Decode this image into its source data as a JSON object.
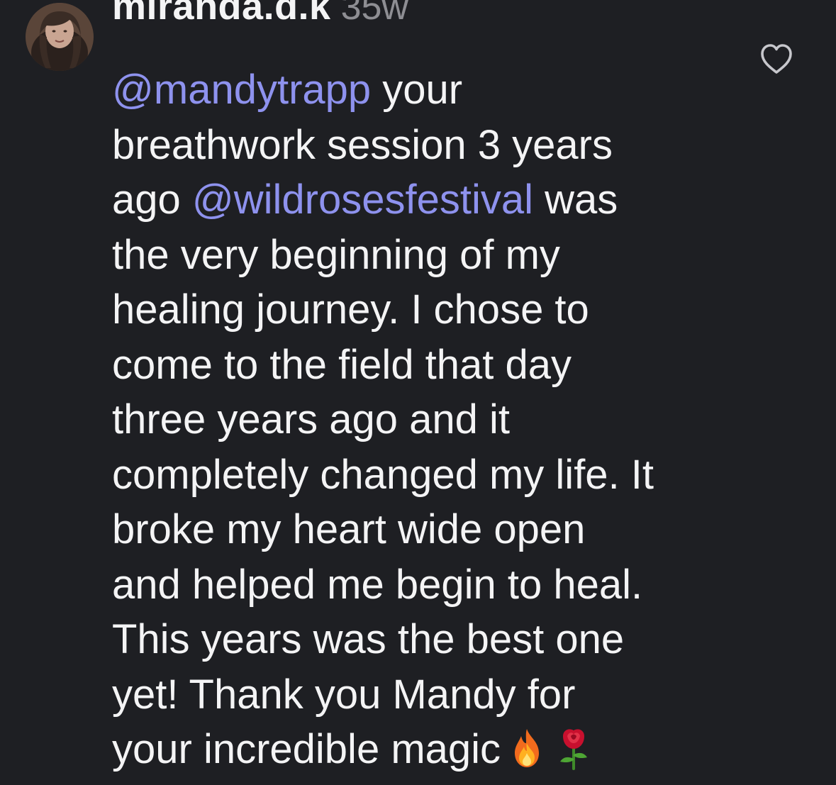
{
  "comment": {
    "username": "miranda.d.k",
    "timestamp": "35w",
    "lines": [
      [
        {
          "t": "mention",
          "text": "@mandytrapp"
        },
        {
          "t": "text",
          "text": " your"
        }
      ],
      [
        {
          "t": "text",
          "text": "breathwork session 3 years"
        }
      ],
      [
        {
          "t": "text",
          "text": "ago "
        },
        {
          "t": "mention",
          "text": "@wildrosesfestival"
        },
        {
          "t": "text",
          "text": " was"
        }
      ],
      [
        {
          "t": "text",
          "text": "the very beginning of my"
        }
      ],
      [
        {
          "t": "text",
          "text": "healing journey. I chose to"
        }
      ],
      [
        {
          "t": "text",
          "text": "come to the field that day"
        }
      ],
      [
        {
          "t": "text",
          "text": "three years ago and it"
        }
      ],
      [
        {
          "t": "text",
          "text": "completely changed my life. It"
        }
      ],
      [
        {
          "t": "text",
          "text": "broke my heart wide open"
        }
      ],
      [
        {
          "t": "text",
          "text": "and helped me begin to heal."
        }
      ],
      [
        {
          "t": "text",
          "text": "This years was the best one"
        }
      ],
      [
        {
          "t": "text",
          "text": "yet! Thank you Mandy for"
        }
      ],
      [
        {
          "t": "text",
          "text": "your incredible magic"
        },
        {
          "t": "emoji",
          "name": "fire-emoji-icon"
        },
        {
          "t": "emoji",
          "name": "rose-emoji-icon"
        }
      ]
    ]
  },
  "icons": {
    "like": "heart-outline-icon",
    "avatar": "user-avatar"
  },
  "colors": {
    "background": "#1e1f23",
    "text": "#f4f4f5",
    "mention": "#8e92ee",
    "timestamp": "#8e8e93"
  }
}
